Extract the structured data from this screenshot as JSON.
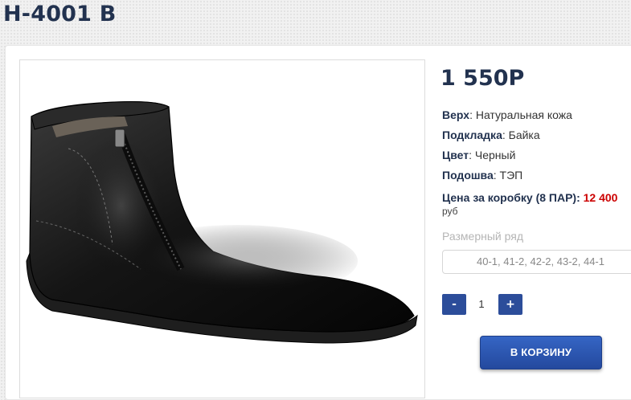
{
  "product": {
    "title": "Н-4001 В",
    "price": "1 550Р",
    "image_alt": "Черный мужской ботинок"
  },
  "specs": [
    {
      "label": "Верх",
      "value": ": Натуральная кожа"
    },
    {
      "label": "Подкладка",
      "value": ": Байка"
    },
    {
      "label": "Цвет",
      "value": ": Черный"
    },
    {
      "label": "Подошва",
      "value": ": ТЭП"
    }
  ],
  "box_price": {
    "label": "Цена за коробку (8 ПАР):",
    "value": "12 400",
    "currency": "руб"
  },
  "sizes": {
    "label": "Размерный ряд",
    "selected": "40-1, 41-2, 42-2, 43-2, 44-1"
  },
  "quantity": {
    "minus_label": "-",
    "value": "1",
    "plus_label": "+"
  },
  "cart_button": "В КОРЗИНУ",
  "colors": {
    "brand_navy": "#22324f",
    "button_blue": "#2c4d9a",
    "price_red": "#cc0000"
  }
}
